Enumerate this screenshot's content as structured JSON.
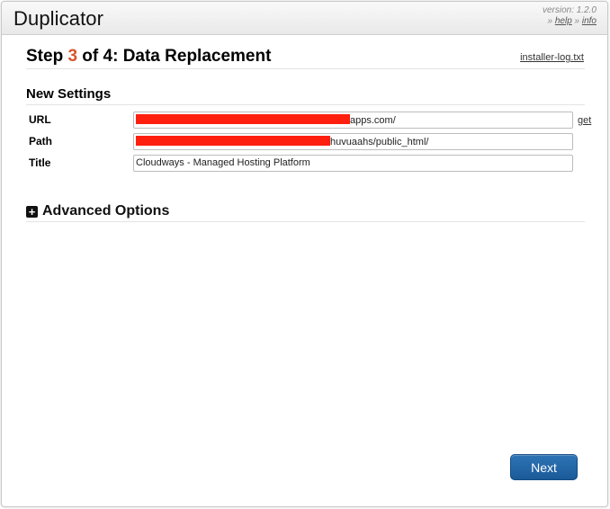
{
  "header": {
    "app_title": "Duplicator",
    "version_text": "version: 1.2.0",
    "sep1": "»",
    "help_label": "help",
    "sep2": "»",
    "info_label": "info"
  },
  "step": {
    "prefix": "Step ",
    "number": "3",
    "suffix": " of 4: Data Replacement",
    "log_link": "installer-log.txt"
  },
  "new_settings": {
    "title": "New Settings",
    "fields": [
      {
        "label": "URL",
        "value_visible": "apps.com/",
        "redacted": true
      },
      {
        "label": "Path",
        "value_visible": "huvuaahs/public_html/",
        "redacted": true
      },
      {
        "label": "Title",
        "value_visible": "Cloudways - Managed Hosting Platform",
        "redacted": false
      }
    ],
    "get_link": "get"
  },
  "advanced": {
    "label": "Advanced Options",
    "icon": "plus-square-icon"
  },
  "actions": {
    "next_label": "Next"
  },
  "colors": {
    "step_number": "#d9542c",
    "button": "#1f62a5",
    "redaction": "#ff1f0f"
  }
}
